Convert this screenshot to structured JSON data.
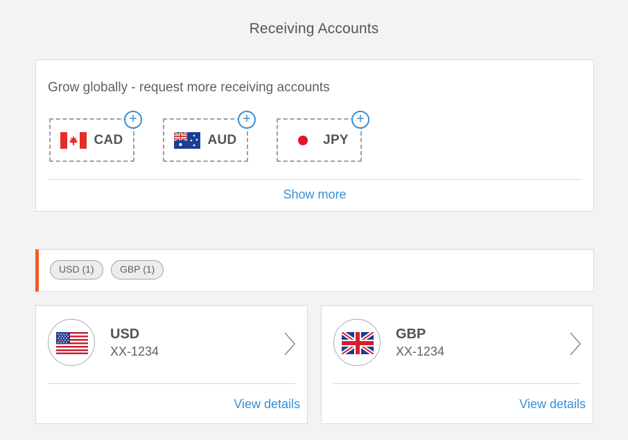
{
  "page": {
    "title": "Receiving Accounts"
  },
  "grow": {
    "heading": "Grow globally - request more receiving accounts",
    "currencies": [
      {
        "code": "CAD",
        "flag_icon": "canada-flag-icon"
      },
      {
        "code": "AUD",
        "flag_icon": "australia-flag-icon"
      },
      {
        "code": "JPY",
        "flag_icon": "japan-flag-icon"
      }
    ],
    "add_icon": "plus-icon",
    "show_more_label": "Show more"
  },
  "filters": [
    {
      "label": "USD (1)"
    },
    {
      "label": "GBP (1)"
    }
  ],
  "accounts": [
    {
      "code": "USD",
      "number": "XX-1234",
      "view_label": "View details",
      "flag_icon": "us-flag-icon"
    },
    {
      "code": "GBP",
      "number": "XX-1234",
      "view_label": "View details",
      "flag_icon": "uk-flag-icon"
    }
  ],
  "colors": {
    "accent": "#3a8ed3",
    "filter_bar_marker": "#f15a29",
    "background": "#f3f3f3"
  }
}
